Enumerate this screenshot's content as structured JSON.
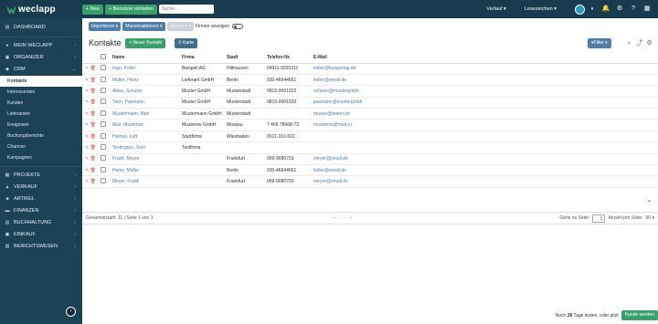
{
  "topbar": {
    "logo": "weclapp",
    "new_label": "Neu",
    "invite_label": "Benutzer einladen",
    "search_placeholder": "Suche...",
    "history_label": "Verlauf",
    "bookmarks_label": "Lesezeichen"
  },
  "sidebar": {
    "items": [
      {
        "label": "DASHBOARD",
        "icon": "dashboard-icon"
      },
      {
        "label": "MEIN WECLAPP",
        "icon": "user-icon"
      },
      {
        "label": "ORGANIZER",
        "icon": "calendar-icon"
      },
      {
        "label": "CRM",
        "icon": "crm-icon"
      }
    ],
    "crm_sub": [
      "Kontakte",
      "Interessenten",
      "Kunden",
      "Lieferanten",
      "Ereignisse",
      "Buchungsberichte",
      "Chancen",
      "Kampagnen"
    ],
    "items2": [
      {
        "label": "PROJEKTE",
        "icon": "projects-icon"
      },
      {
        "label": "VERKAUF",
        "icon": "sales-icon"
      },
      {
        "label": "ARTIKEL",
        "icon": "article-icon"
      },
      {
        "label": "FINANZEN",
        "icon": "finance-icon"
      },
      {
        "label": "BUCHHALTUNG",
        "icon": "accounting-icon"
      },
      {
        "label": "EINKAUF",
        "icon": "purchase-icon"
      },
      {
        "label": "BERICHTSWESEN",
        "icon": "reports-icon"
      }
    ]
  },
  "toolbar": {
    "import_label": "Importieren",
    "mass_label": "Massenaktionen",
    "action_label": "Aktionen",
    "show_companies_label": "Firmen anzeigen"
  },
  "page": {
    "title": "Kontakte",
    "new_contact_label": "Neuer Kontakt",
    "map_label": "Karte",
    "filter_label": "Filter"
  },
  "table": {
    "headers": [
      "Name",
      "Firma",
      "Stadt",
      "Telefon-Nr.",
      "E-Mail"
    ],
    "rows": [
      [
        "Ingo, Köller",
        "Beispiel AG",
        "Hilthausen",
        "04911-9320311",
        "koller@beispielag.de"
      ],
      [
        "Müller, Heinz",
        "Lieferant GmbH",
        "Berlin",
        "030-46644661",
        "koller@email.de"
      ],
      [
        "Alitas, Schulze",
        "Muster GmbH",
        "Musterstadt",
        "0815-9001022",
        "schulze@mustergmbh"
      ],
      [
        "Tann, Pasmann",
        "Muster GmbH",
        "Musterstadt",
        "0815-9001020",
        "pasmann@mustergmbh"
      ],
      [
        "Mustermann, Max",
        "Mustermann GmbH",
        "Musterstadt",
        "",
        "muster@mann.de"
      ],
      [
        "Max, Musterow",
        "Musterow GmbH",
        "Moskau",
        "7 456 78668-73",
        "musterow@mail.ru"
      ],
      [
        "Helmut, Luft",
        "Startfirma",
        "Wiesbaden",
        "0611-310-502",
        ""
      ],
      [
        "Testington, Testl",
        "Testfirma",
        "",
        "",
        ""
      ],
      [
        "Frank, Meyer",
        "",
        "Frankfurt",
        "069-9080703",
        "meyer@email.de"
      ],
      [
        "Heinz, Müller",
        "",
        "Berlin",
        "030-46644661",
        "koller@email.de"
      ],
      [
        "Meyer, Frank",
        "",
        "Frankfurt",
        "069-9080703",
        "meyer@email.de"
      ]
    ]
  },
  "pagination": {
    "summary": "Gesamtanzahl: 11 | Seite 1 von 1",
    "goto_label": "Gehe zu Seite:",
    "page_value": "1",
    "per_page_label": "Anzahl pro Seite:",
    "per_page_value": "50"
  },
  "footer": {
    "trial_prefix": "Noch",
    "trial_days": "28",
    "trial_suffix": "Tage testen, oder jetzt",
    "become_customer_label": "Kunde werden"
  },
  "colors": {
    "accent": "#38a169",
    "topbar": "#183b4d",
    "sidebar": "#1c4255",
    "link": "#4f7ea8"
  }
}
